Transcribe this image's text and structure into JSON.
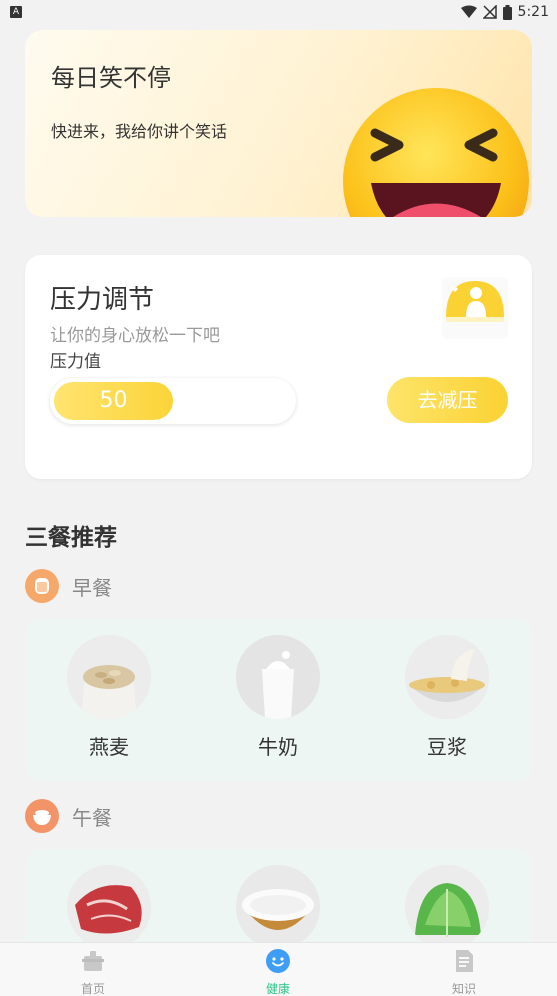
{
  "status_bar": {
    "time": "5:21",
    "notification_glyph": "A"
  },
  "joke_card": {
    "title": "每日笑不停",
    "subtitle": "快进来，我给你讲个笑话",
    "icon": "laughing-emoji"
  },
  "stress_card": {
    "title": "压力调节",
    "subtitle": "让你的身心放松一下吧",
    "value_label": "压力值",
    "value": "50",
    "button_label": "去减压"
  },
  "meals": {
    "title": "三餐推荐",
    "breakfast": {
      "label": "早餐",
      "items": [
        {
          "name": "燕麦"
        },
        {
          "name": "牛奶"
        },
        {
          "name": "豆浆"
        }
      ]
    },
    "lunch": {
      "label": "午餐",
      "items": [
        {
          "name": ""
        },
        {
          "name": ""
        },
        {
          "name": ""
        }
      ]
    }
  },
  "tabbar": {
    "tabs": [
      {
        "label": "首页",
        "icon": "home-icon"
      },
      {
        "label": "健康",
        "icon": "smile-icon"
      },
      {
        "label": "知识",
        "icon": "document-icon"
      }
    ],
    "active_color": "#2dc38a"
  }
}
